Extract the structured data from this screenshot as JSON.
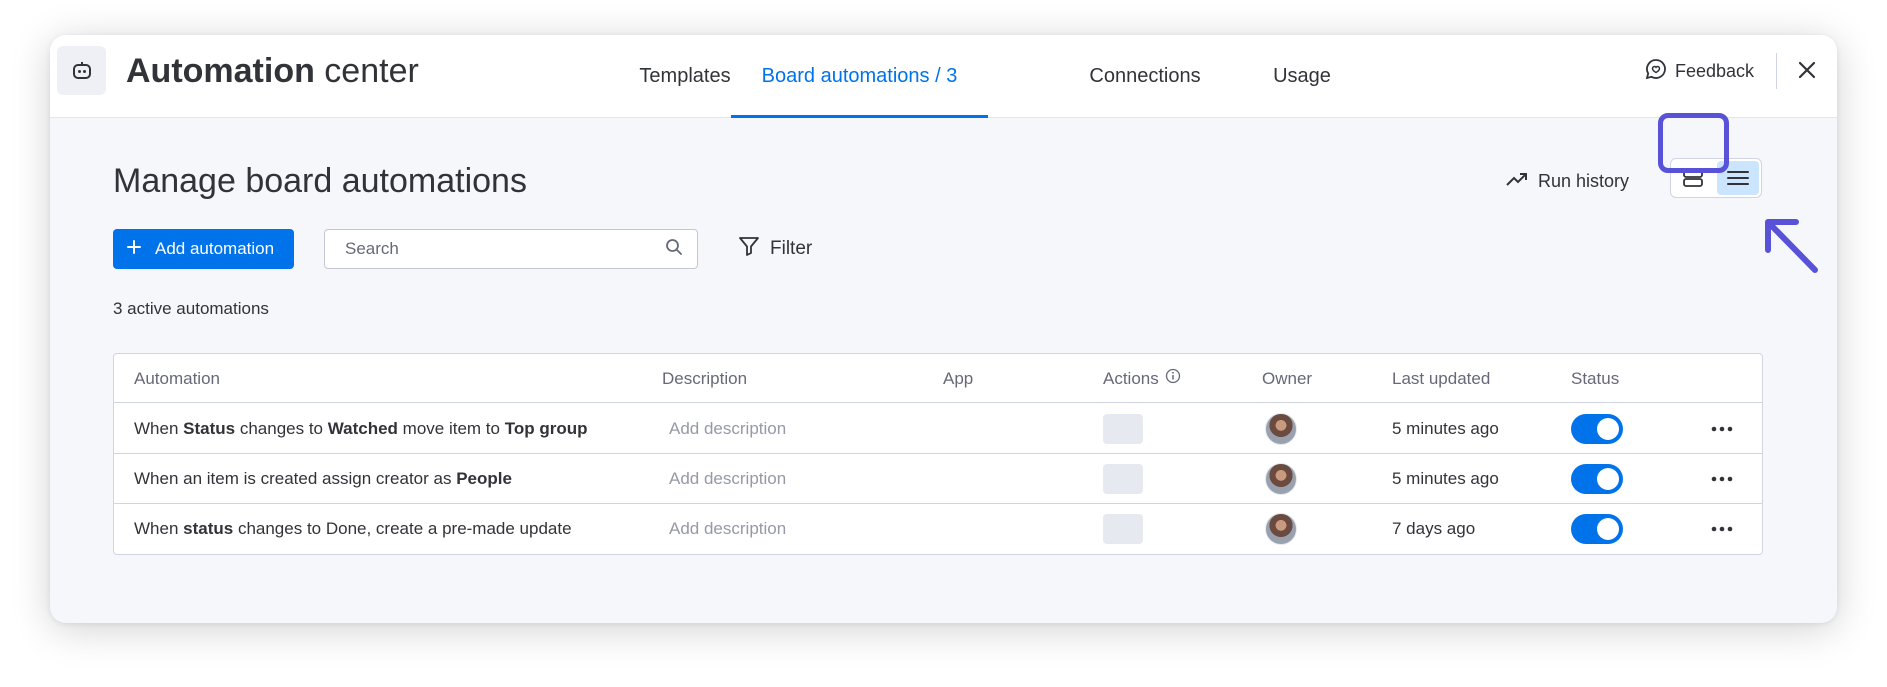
{
  "header": {
    "title_bold": "Automation",
    "title_rest": " center",
    "tabs": [
      {
        "label": "Templates"
      },
      {
        "label": "Board automations / 3"
      },
      {
        "label": "Connections"
      },
      {
        "label": "Usage"
      }
    ],
    "feedback_label": "Feedback"
  },
  "main": {
    "title": "Manage board automations",
    "run_history_label": "Run history",
    "add_button_label": "Add automation",
    "search_placeholder": "Search",
    "filter_label": "Filter",
    "active_count_text": "3 active automations"
  },
  "table": {
    "columns": [
      "Automation",
      "Description",
      "App",
      "Actions",
      "Owner",
      "Last updated",
      "Status"
    ],
    "rows": [
      {
        "parts": [
          {
            "text": "When ",
            "bold": false
          },
          {
            "text": "Status",
            "bold": true
          },
          {
            "text": " changes to ",
            "bold": false
          },
          {
            "text": "Watched",
            "bold": true
          },
          {
            "text": " move item to ",
            "bold": false
          },
          {
            "text": "Top group",
            "bold": true
          }
        ],
        "description": "Add description",
        "last_updated": "5 minutes ago",
        "status_on": true
      },
      {
        "parts": [
          {
            "text": "When an item is created assign creator as ",
            "bold": false
          },
          {
            "text": "People",
            "bold": true
          }
        ],
        "description": "Add description",
        "last_updated": "5 minutes ago",
        "status_on": true
      },
      {
        "parts": [
          {
            "text": "When ",
            "bold": false
          },
          {
            "text": "status",
            "bold": true
          },
          {
            "text": " changes to Done, create a pre-made update",
            "bold": false
          }
        ],
        "description": "Add description",
        "last_updated": "7 days ago",
        "status_on": true
      }
    ]
  },
  "colors": {
    "accent": "#0073ea",
    "annotation": "#5752d8",
    "selected_view_bg": "#cce5ff"
  },
  "icons": [
    "robot-icon",
    "feedback-icon",
    "close-icon",
    "trend-icon",
    "card-view-icon",
    "list-view-icon",
    "plus-icon",
    "search-icon",
    "filter-icon",
    "info-icon",
    "more-icon"
  ]
}
